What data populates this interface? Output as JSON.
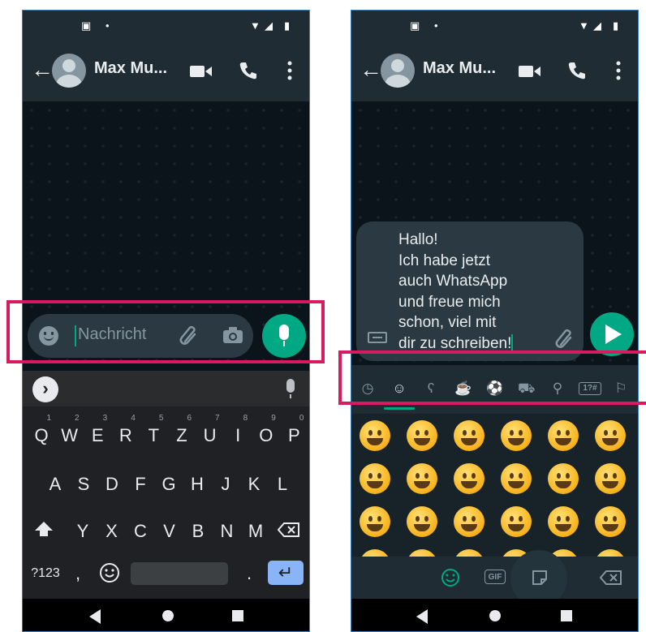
{
  "left_screen": {
    "contact_name": "Max Mu...",
    "message_placeholder": "Nachricht",
    "keyboard": {
      "row1": [
        {
          "key": "Q",
          "hint": "1"
        },
        {
          "key": "W",
          "hint": "2"
        },
        {
          "key": "E",
          "hint": "3"
        },
        {
          "key": "R",
          "hint": "4"
        },
        {
          "key": "T",
          "hint": "5"
        },
        {
          "key": "Z",
          "hint": "6"
        },
        {
          "key": "U",
          "hint": "7"
        },
        {
          "key": "I",
          "hint": "8"
        },
        {
          "key": "O",
          "hint": "9"
        },
        {
          "key": "P",
          "hint": "0"
        }
      ],
      "row2": [
        "A",
        "S",
        "D",
        "F",
        "G",
        "H",
        "J",
        "K",
        "L"
      ],
      "row3": [
        "Y",
        "X",
        "C",
        "V",
        "B",
        "N",
        "M"
      ],
      "symbols_label": "?123",
      "comma_label": ",",
      "period_label": "."
    }
  },
  "right_screen": {
    "contact_name": "Max Mu...",
    "message_text": "Hallo!\nIch habe jetzt\nauch WhatsApp\nund freue mich\nschon, viel mit\ndir zu schreiben!",
    "emoji_categories": [
      "recent-icon",
      "smileys-icon",
      "animals-icon",
      "food-icon",
      "activity-icon",
      "travel-icon",
      "objects-icon",
      "symbols-icon",
      "flags-icon"
    ],
    "symbols_tab_label": "1?#",
    "gif_label": "GIF"
  },
  "colors": {
    "accent_green": "#00a884",
    "header_bg": "#202c33",
    "highlight_red": "#d81b60",
    "keyboard_bg": "#202124",
    "enter_key_blue": "#8ab4f8"
  }
}
